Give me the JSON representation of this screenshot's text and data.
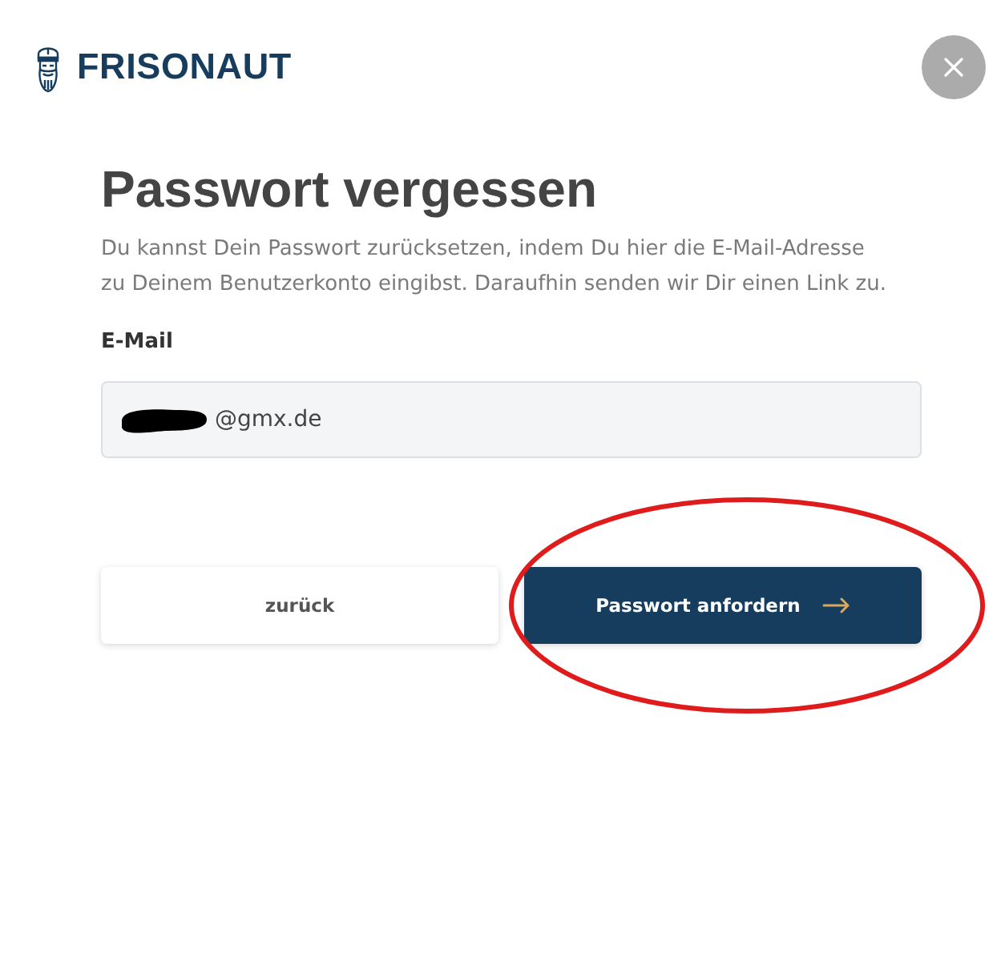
{
  "header": {
    "logo_text": "FRISONAUT"
  },
  "form": {
    "title": "Passwort vergessen",
    "description": "Du kannst Dein Passwort zurücksetzen, indem Du hier die E-Mail-Adresse\nzu Deinem Benutzerkonto eingibst. Daraufhin senden wir Dir einen Link zu.",
    "email_label": "E-Mail",
    "email_value": "@gmx.de"
  },
  "buttons": [
    {
      "label": "zurück",
      "kind": "secondary"
    },
    {
      "label": "Passwort anfordern",
      "kind": "primary"
    }
  ]
}
